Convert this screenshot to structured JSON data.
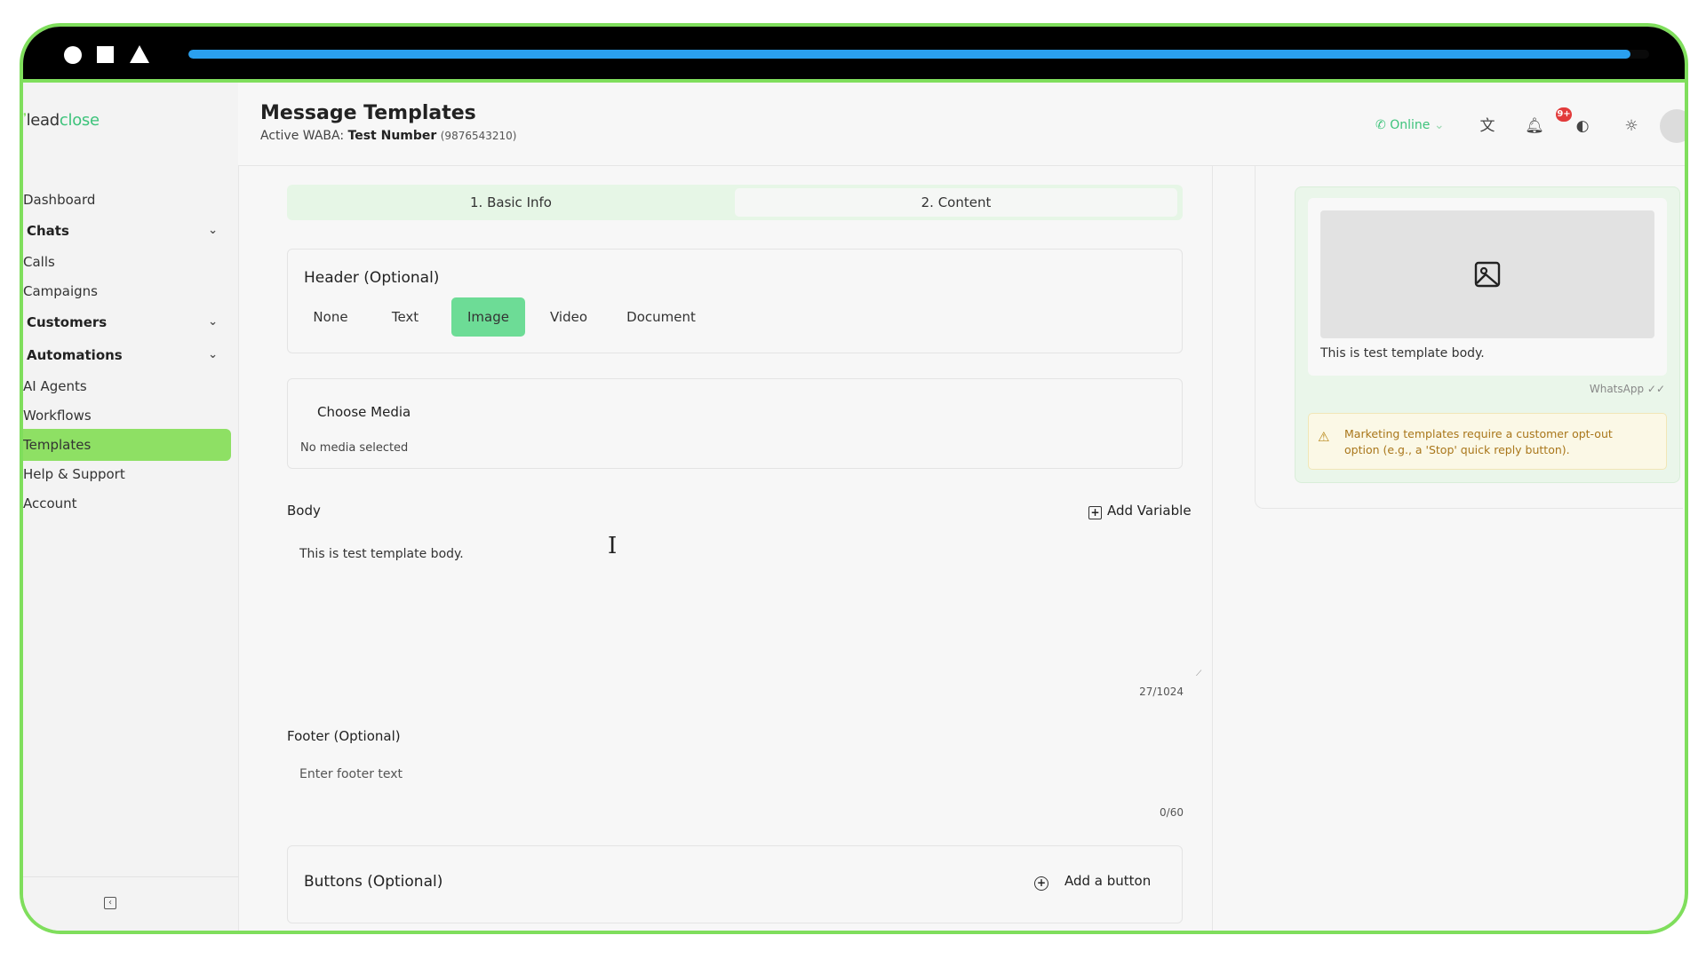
{
  "recording_bar": {
    "progress": 0.987
  },
  "colors": {
    "accent": "#8ee064",
    "brand": "#3dc37b",
    "selected_segment": "#6ddc96",
    "frame": "#7fde5c",
    "progress": "#2aa0ef"
  },
  "sidebar": {
    "logo_lead": "lead",
    "logo_close": "close",
    "items": [
      {
        "label": "Dashboard"
      },
      {
        "label": "Chats"
      },
      {
        "label": "Calls"
      },
      {
        "label": "Campaigns"
      },
      {
        "label": "Customers"
      },
      {
        "label": "Automations"
      },
      {
        "label": "AI Agents"
      },
      {
        "label": "Workflows"
      },
      {
        "label": "Templates"
      },
      {
        "label": "Help & Support"
      },
      {
        "label": "Account"
      }
    ],
    "active": "Templates"
  },
  "header": {
    "title": "Message Templates",
    "waba_prefix": "Active WABA:",
    "waba_name": "Test Number",
    "waba_phone": "(9876543210)",
    "status": "Online",
    "notif_badge": "9+"
  },
  "steps": {
    "tab1": "1. Basic Info",
    "tab2": "2. Content"
  },
  "header_section": {
    "title": "Header (Optional)",
    "options": [
      "None",
      "Text",
      "Image",
      "Video",
      "Document"
    ],
    "selected": "Image"
  },
  "media": {
    "title": "Choose Media",
    "status": "No media selected"
  },
  "body": {
    "label": "Body",
    "add_variable": "Add Variable",
    "text": "This is test template body.",
    "counter": "27/1024"
  },
  "footer": {
    "label": "Footer (Optional)",
    "placeholder": "Enter footer text",
    "counter": "0/60"
  },
  "buttons": {
    "title": "Buttons (Optional)",
    "add_label": "Add a button"
  },
  "preview": {
    "body_text": "This is test template body.",
    "whatsapp_tag": "WhatsApp ✓✓",
    "warning": "Marketing templates require a customer opt-out option (e.g., a 'Stop' quick reply button)."
  }
}
